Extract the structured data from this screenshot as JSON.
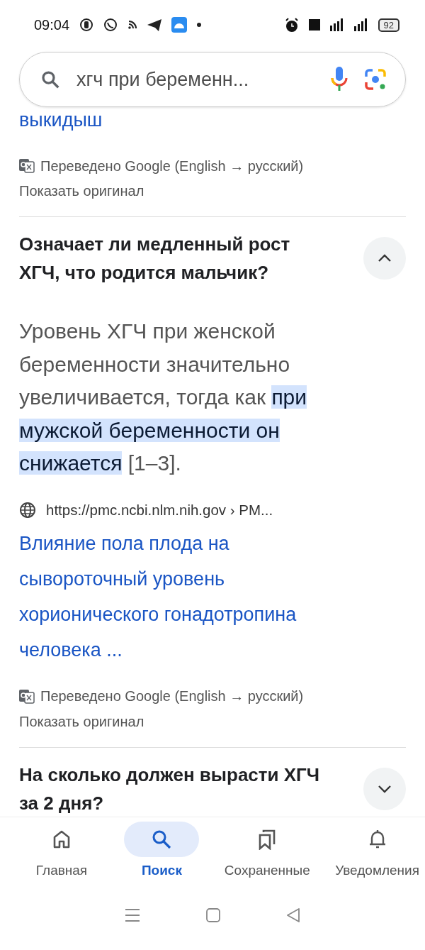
{
  "status_bar": {
    "time": "09:04",
    "battery": "92"
  },
  "search": {
    "value": "хгч при беременн..."
  },
  "top_fragment": {
    "link_tail": "выкидыш",
    "translation_note": "Переведено Google (English → русский)",
    "show_original": "Показать оригинал"
  },
  "questions": [
    {
      "question": "Означает ли медленный рост ХГЧ, что родится мальчик?",
      "expanded": true,
      "answer": [
        {
          "text": "Уровень ХГЧ при женской беременности значительно увеличивается, тогда как ",
          "highlighted": false
        },
        {
          "text": "при мужской беременности он снижается",
          "highlighted": true
        },
        {
          "text": " [1–3].",
          "highlighted": false
        }
      ],
      "source_url": "https://pmc.ncbi.nlm.nih.gov › PM...",
      "source_title": "Влияние пола плода на сывороточный уровень хорионического гонадотропина человека ...",
      "translation_note": "Переведено Google (English → русский)",
      "show_original": "Показать оригинал"
    },
    {
      "question": "На сколько должен вырасти ХГЧ за 2 дня?",
      "expanded": false
    }
  ],
  "nav": [
    {
      "label": "Главная",
      "selected": false,
      "kind": "home"
    },
    {
      "label": "Поиск",
      "selected": true,
      "kind": "search"
    },
    {
      "label": "Сохраненные",
      "selected": false,
      "kind": "saved"
    },
    {
      "label": "Уведомления",
      "selected": false,
      "kind": "bell"
    }
  ]
}
